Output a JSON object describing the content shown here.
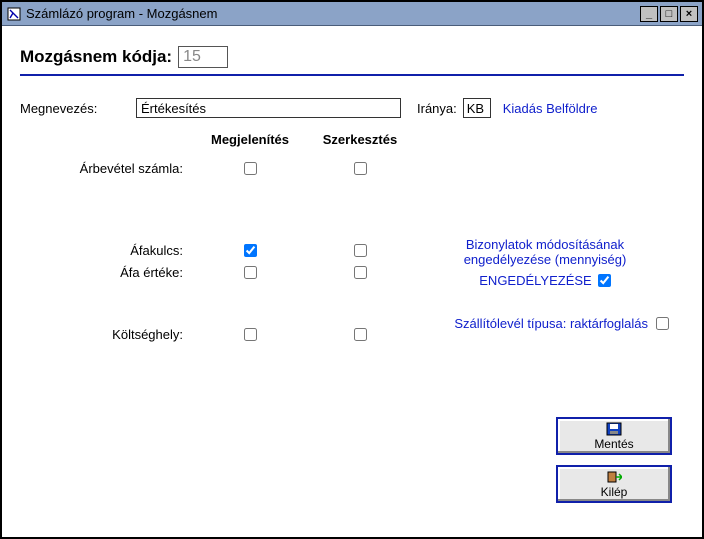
{
  "window": {
    "title": "Számlázó program   -   Mozgásnem"
  },
  "code": {
    "label": "Mozgásnem kódja:",
    "value": "15"
  },
  "name": {
    "label": "Megnevezés:",
    "value": "Értékesítés"
  },
  "direction": {
    "label": "Iránya:",
    "value": "KB",
    "desc": "Kiadás Belföldre"
  },
  "columns": {
    "display": "Megjelenítés",
    "edit": "Szerkesztés"
  },
  "rows": {
    "revenue": {
      "label": "Árbevétel számla:",
      "display": false,
      "edit": false
    },
    "vatkey": {
      "label": "Áfakulcs:",
      "display": true,
      "edit": false
    },
    "vatval": {
      "label": "Áfa értéke:",
      "display": false,
      "edit": false
    },
    "cost": {
      "label": "Költséghely:",
      "display": false,
      "edit": false
    }
  },
  "permissions": {
    "line1": "Bizonylatok módosításának",
    "line2": "engedélyezése (mennyiség)",
    "enable_label": "ENGEDÉLYEZÉSE",
    "enable_checked": true,
    "ship_label": "Szállítólevél típusa: raktárfoglalás",
    "ship_checked": false
  },
  "buttons": {
    "save": "Mentés",
    "exit": "Kilép"
  }
}
